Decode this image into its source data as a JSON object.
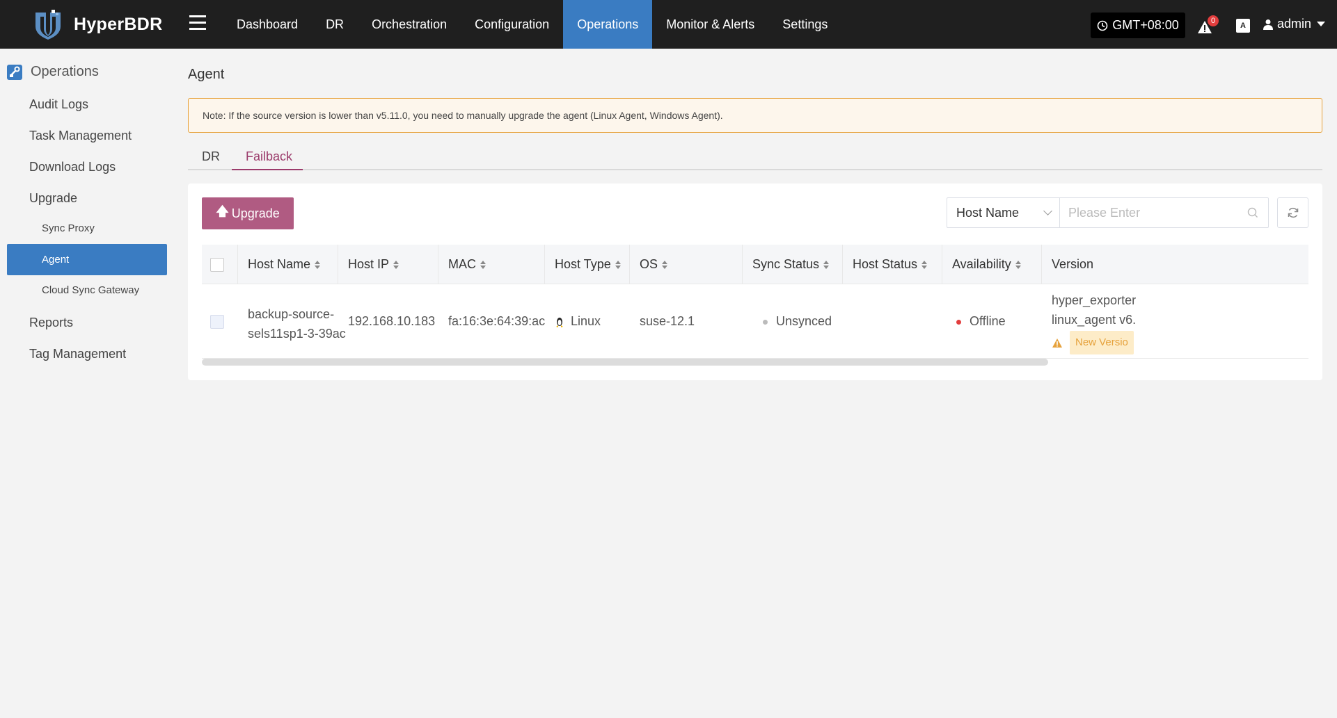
{
  "app": {
    "name": "HyperBDR"
  },
  "nav": {
    "items": [
      {
        "label": "Dashboard",
        "active": false
      },
      {
        "label": "DR",
        "active": false
      },
      {
        "label": "Orchestration",
        "active": false
      },
      {
        "label": "Configuration",
        "active": false
      },
      {
        "label": "Operations",
        "active": true
      },
      {
        "label": "Monitor & Alerts",
        "active": false
      },
      {
        "label": "Settings",
        "active": false
      }
    ],
    "timezone": "GMT+08:00",
    "alert_count": "0",
    "lang_icon": "translate-icon",
    "user": "admin"
  },
  "sidebar": {
    "header": "Operations",
    "items": [
      {
        "label": "Audit Logs"
      },
      {
        "label": "Task Management"
      },
      {
        "label": "Download Logs"
      },
      {
        "label": "Upgrade"
      },
      {
        "label": "Sync Proxy"
      },
      {
        "label": "Agent"
      },
      {
        "label": "Cloud Sync Gateway"
      },
      {
        "label": "Reports"
      },
      {
        "label": "Tag Management"
      }
    ]
  },
  "main": {
    "title": "Agent",
    "note": "Note: If the source version is lower than v5.11.0, you need to manually upgrade the agent (Linux Agent, Windows Agent).",
    "tabs": [
      {
        "label": "DR",
        "active": false
      },
      {
        "label": "Failback",
        "active": true
      }
    ],
    "upgrade_label": "Upgrade",
    "search": {
      "field": "Host Name",
      "placeholder": "Please Enter"
    },
    "table": {
      "columns": [
        "Host Name",
        "Host IP",
        "MAC",
        "Host Type",
        "OS",
        "Sync Status",
        "Host Status",
        "Availability",
        "Version"
      ],
      "rows": [
        {
          "host_name_line1": "backup-source-",
          "host_name_line2": "sels11sp1-3-39ac",
          "host_ip": "192.168.10.183",
          "mac": "fa:16:3e:64:39:ac",
          "host_type": "Linux",
          "os": "suse-12.1",
          "sync_status": "Unsynced",
          "host_status": "",
          "availability": "Offline",
          "version_line1": "hyper_exporter",
          "version_line2": "linux_agent v6.",
          "version_badge": "New Versio"
        }
      ]
    }
  },
  "colors": {
    "topbar": "#1f1f1f",
    "nav_active": "#3a7cc2",
    "accent": "#b05b82",
    "tab_active": "#9b3b6b",
    "offline": "#e23d3d",
    "warning": "#e6a23c"
  }
}
